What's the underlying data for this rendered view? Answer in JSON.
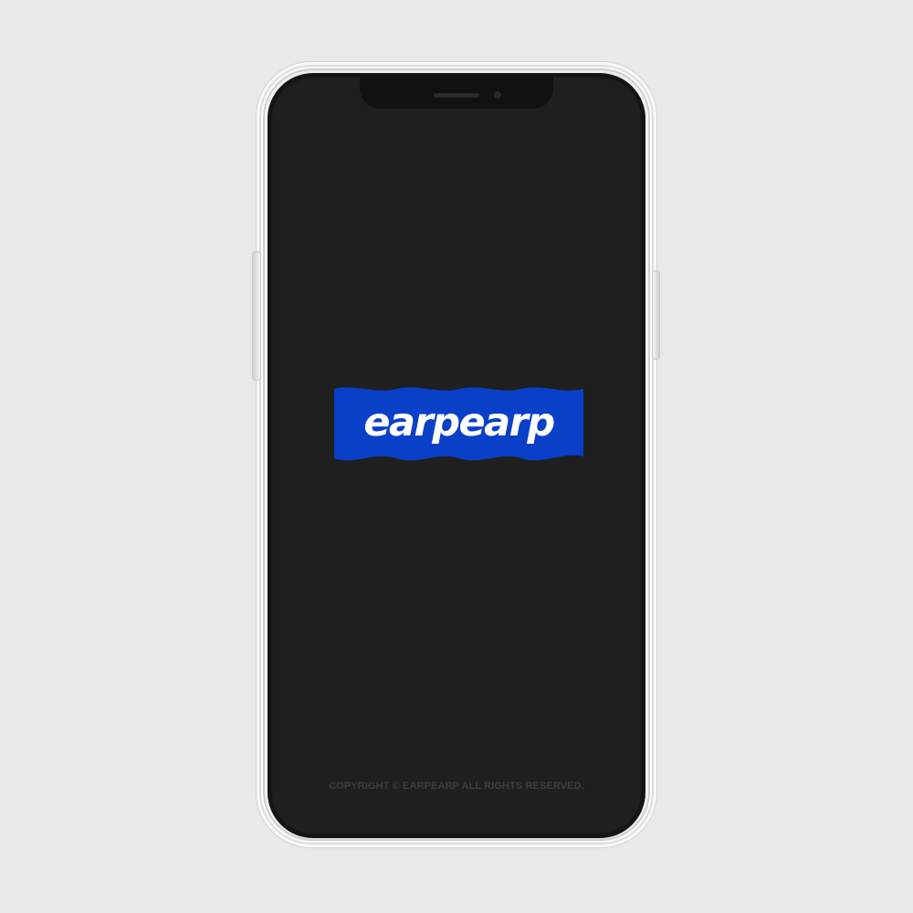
{
  "device": {
    "type": "smartphone in clear case",
    "background_color": "#e9e9e9",
    "screen_color": "#1f1f1f"
  },
  "logo": {
    "text": "earpearp",
    "badge_color": "#0a40c8",
    "text_color": "#ffffff"
  },
  "footer": {
    "copyright": "COPYRIGHT © EARPEARP ALL RIGHTS RESERVED."
  },
  "icons": {
    "speaker": "speaker-grille-icon",
    "camera": "front-camera-icon"
  }
}
